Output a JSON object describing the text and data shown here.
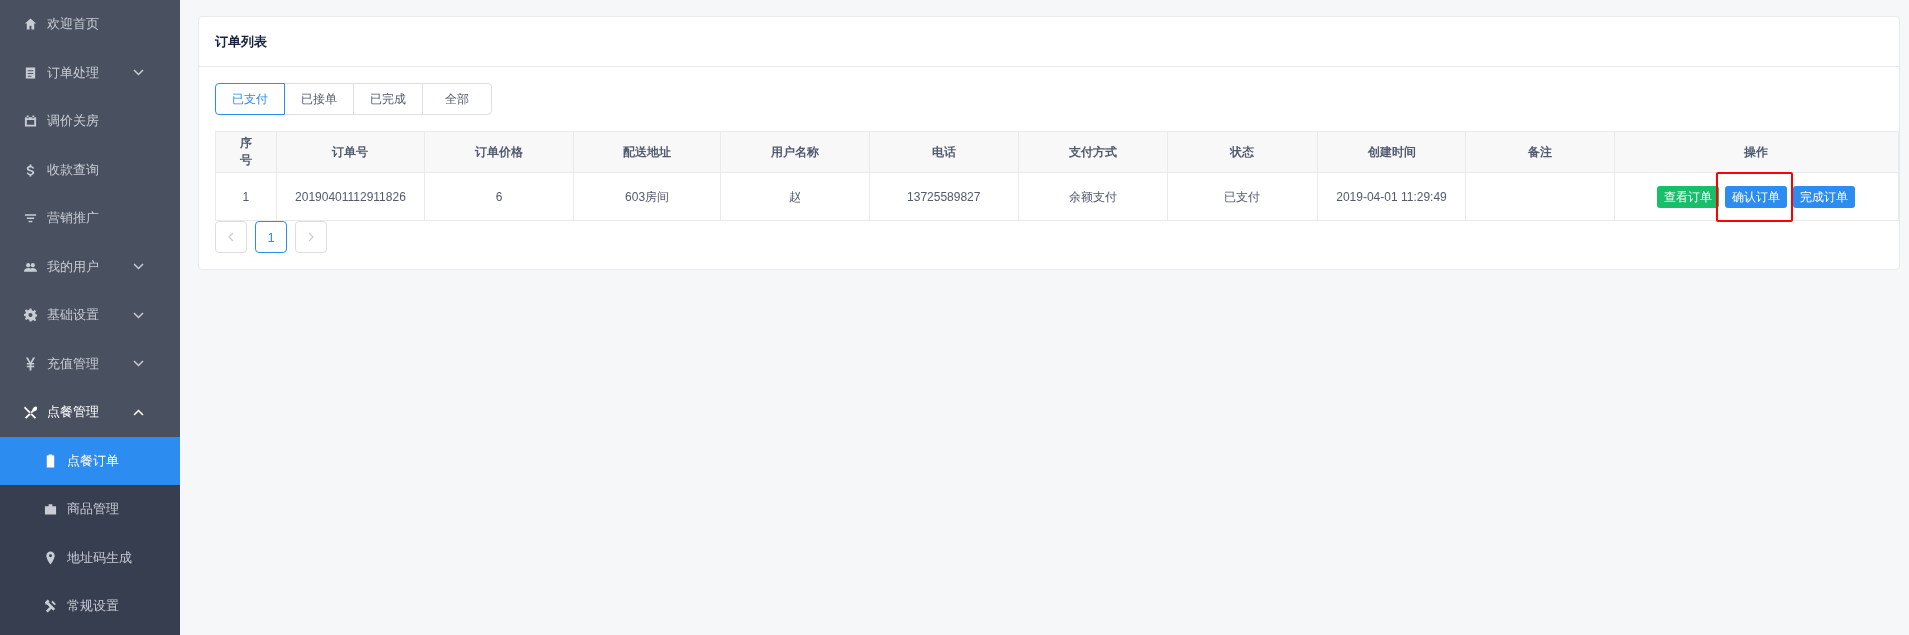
{
  "sidebar": {
    "items": [
      {
        "label": "欢迎首页",
        "selected": false
      },
      {
        "label": "订单处理",
        "selected": false,
        "expanded": false
      },
      {
        "label": "调价关房",
        "selected": false
      },
      {
        "label": "收款查询",
        "selected": false
      },
      {
        "label": "营销推广",
        "selected": false
      },
      {
        "label": "我的用户",
        "selected": false,
        "expanded": false
      },
      {
        "label": "基础设置",
        "selected": false,
        "expanded": false
      },
      {
        "label": "充值管理",
        "selected": false,
        "expanded": false
      },
      {
        "label": "点餐管理",
        "selected": false,
        "expanded": true,
        "children": [
          {
            "label": "点餐订单",
            "selected": true
          },
          {
            "label": "商品管理",
            "selected": false
          },
          {
            "label": "地址码生成",
            "selected": false
          },
          {
            "label": "常规设置",
            "selected": false
          }
        ]
      }
    ]
  },
  "card": {
    "title": "订单列表",
    "tabs": [
      {
        "label": "已支付",
        "selected": true
      },
      {
        "label": "已接单",
        "selected": false
      },
      {
        "label": "已完成",
        "selected": false
      },
      {
        "label": "全部",
        "selected": false
      }
    ],
    "table": {
      "columns": [
        "序号",
        "订单号",
        "订单价格",
        "配送地址",
        "用户名称",
        "电话",
        "支付方式",
        "状态",
        "创建时间",
        "备注",
        "操作"
      ],
      "rows": [
        {
          "cells": [
            "1",
            "20190401112911826",
            "6",
            "603房间",
            "赵",
            "13725589827",
            "余额支付",
            "已支付",
            "2019-04-01 11:29:49",
            ""
          ],
          "actions": [
            {
              "label": "查看订单",
              "color": "#19be6b",
              "highlighted": false
            },
            {
              "label": "确认订单",
              "color": "#2d8cf0",
              "highlighted": true
            },
            {
              "label": "完成订单",
              "color": "#2d8cf0",
              "highlighted": false
            }
          ]
        }
      ]
    },
    "pagination": {
      "prev_disabled": true,
      "next_disabled": true,
      "pages": [
        {
          "label": "1",
          "selected": true
        }
      ]
    }
  }
}
